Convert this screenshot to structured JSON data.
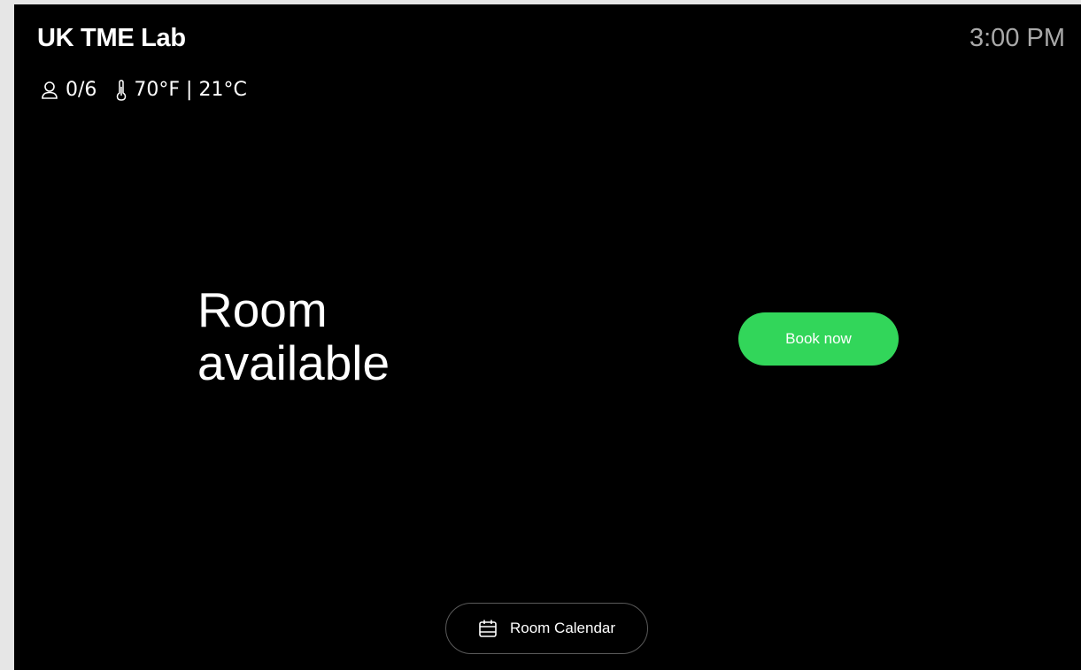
{
  "header": {
    "room_name": "UK TME Lab",
    "time": "3:00 PM"
  },
  "status": {
    "occupancy": "0/6",
    "temperature": "70°F | 21°C",
    "occupancy_icon": "person-icon",
    "temperature_icon": "thermometer-icon"
  },
  "main": {
    "headline_line1": "Room",
    "headline_line2": "available",
    "book_button_label": "Book now"
  },
  "footer": {
    "calendar_button_label": "Room Calendar",
    "calendar_icon": "calendar-icon"
  },
  "colors": {
    "background": "#000000",
    "accent_green": "#32d65a",
    "clock_text": "#a9a9a9"
  }
}
